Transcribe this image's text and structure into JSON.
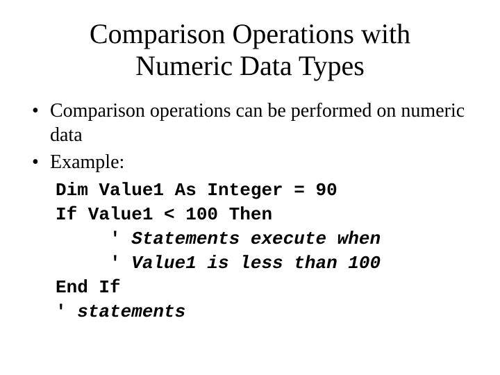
{
  "slide": {
    "title_line1": "Comparison Operations with",
    "title_line2": "Numeric Data Types",
    "bullets": [
      "Comparison operations can be performed on numeric data",
      "Example:"
    ],
    "code": {
      "l1": "Dim Value1 As Integer = 90",
      "l2": "If Value1 < 100 Then",
      "l3_pre": "     ' ",
      "l3_it": "Statements execute when",
      "l4_pre": "     ' ",
      "l4_it": "Value1 is less than 100",
      "l5": "End If",
      "l6_pre": "' ",
      "l6_it": "statements"
    }
  }
}
